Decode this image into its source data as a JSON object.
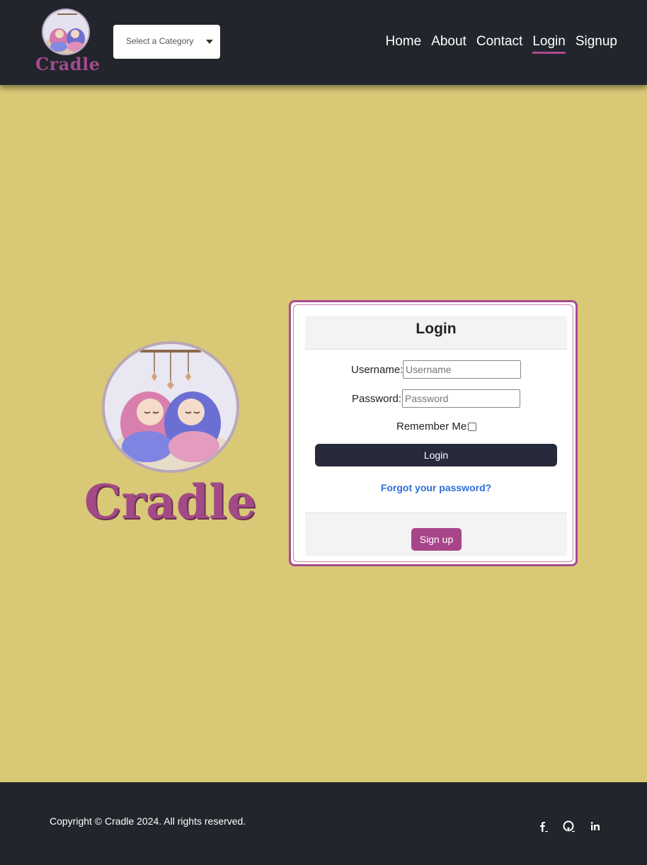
{
  "header": {
    "brand_text": "Cradle",
    "category_select": "Select a Category",
    "nav": [
      "Home",
      "About",
      "Contact",
      "Login",
      "Signup"
    ],
    "active_nav": "Login"
  },
  "hero": {
    "brand_text": "Cradle"
  },
  "login_card": {
    "title": "Login",
    "username_label": "Username:",
    "username_placeholder": "Username",
    "password_label": "Password:",
    "password_placeholder": "Password",
    "remember_label": "Remember Me:",
    "login_button": "Login",
    "forgot_link": "Forgot your password?",
    "signup_button": "Sign up"
  },
  "footer": {
    "copyright": "Copyright © Cradle 2024. All rights reserved.",
    "social_icons": [
      "facebook-icon",
      "github-icon",
      "linkedin-icon"
    ]
  },
  "colors": {
    "header_bg": "#23252c",
    "page_bg": "#d9c876",
    "accent": "#a8458a",
    "link": "#2d6fd9"
  }
}
